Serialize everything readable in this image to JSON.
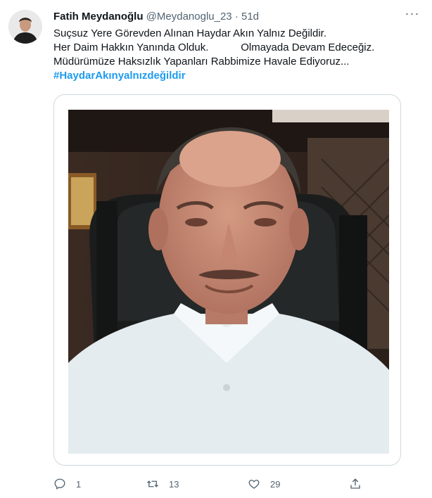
{
  "author": {
    "name": "Fatih Meydanoğlu",
    "handle": "@Meydanoglu_23",
    "separator": "·",
    "time": "51d",
    "avatar_icon": "profile-photo"
  },
  "more_icon": "ellipsis-icon",
  "tweet": {
    "lines": [
      "Suçsuz Yere Görevden Alınan Haydar Akın Yalnız Değildir.",
      "Her Daim Hakkın Yanında Olduk.           Olmayada Devam Edeceğiz.",
      "Müdürümüze Haksızlık Yapanları Rabbimize Havale Ediyoruz..."
    ],
    "hashtag": "#HaydarAkınyalnızdeğildir"
  },
  "media": {
    "description_icon": "photo"
  },
  "actions": {
    "reply": {
      "icon": "reply-icon",
      "count": "1"
    },
    "retweet": {
      "icon": "retweet-icon",
      "count": "13"
    },
    "like": {
      "icon": "like-icon",
      "count": "29"
    },
    "share": {
      "icon": "share-icon"
    }
  },
  "colors": {
    "accent": "#1d9bf0",
    "secondary_text": "#536471",
    "border": "#cfd9de"
  }
}
